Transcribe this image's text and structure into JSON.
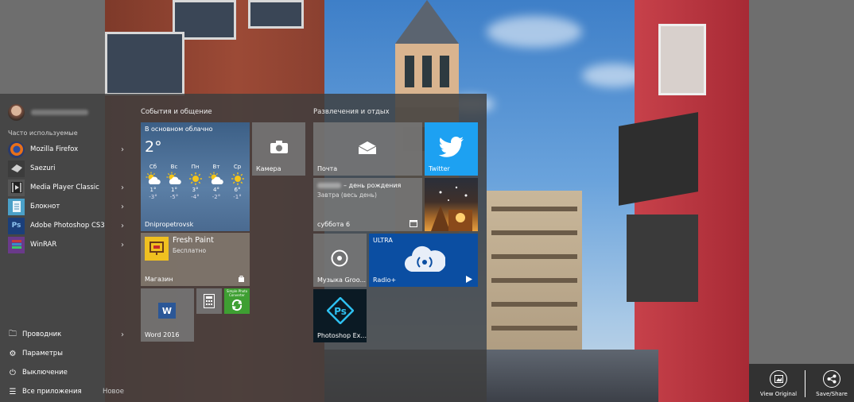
{
  "start_menu": {
    "most_used_label": "Часто используемые",
    "apps": [
      {
        "name": "Mozilla Firefox",
        "icon": "firefox-icon",
        "has_submenu": true
      },
      {
        "name": "Saezuri",
        "icon": "saezuri-icon",
        "has_submenu": false
      },
      {
        "name": "Media Player Classic",
        "icon": "media-player-icon",
        "has_submenu": true
      },
      {
        "name": "Блокнот",
        "icon": "notepad-icon",
        "has_submenu": true
      },
      {
        "name": "Adobe Photoshop CS3",
        "icon": "photoshop-icon",
        "has_submenu": true
      },
      {
        "name": "WinRAR",
        "icon": "winrar-icon",
        "has_submenu": true
      }
    ],
    "bottom": {
      "explorer": "Проводник",
      "settings": "Параметры",
      "power": "Выключение",
      "all_apps": "Все приложения",
      "new_badge": "Новое"
    },
    "group1_title": "События и общение",
    "group2_title": "Развлечения и отдых",
    "weather": {
      "header": "В основном облачно",
      "temp": "2°",
      "city": "Dnipropetrovsk",
      "days": [
        {
          "day": "Сб",
          "hi": "1°",
          "lo": "-3°",
          "icon": "partly-cloudy-icon"
        },
        {
          "day": "Вс",
          "hi": "1°",
          "lo": "-5°",
          "icon": "partly-cloudy-icon"
        },
        {
          "day": "Пн",
          "hi": "3°",
          "lo": "-4°",
          "icon": "sun-icon"
        },
        {
          "day": "Вт",
          "hi": "4°",
          "lo": "-2°",
          "icon": "partly-cloudy-icon"
        },
        {
          "day": "Ср",
          "hi": "6°",
          "lo": "-1°",
          "icon": "sun-icon"
        }
      ]
    },
    "tiles": {
      "camera": "Камера",
      "mail": "Почта",
      "twitter": "Twitter",
      "calendar_event": "– день рождения",
      "calendar_sub": "Завтра (весь день)",
      "calendar_date": "суббота 6",
      "store_app": "Fresh Paint",
      "store_price": "Бесплатно",
      "store_label": "Магазин",
      "music": "Музыка Groo...",
      "radio_brand": "ULTRA",
      "radio_label": "Radio+",
      "word": "Word 2016",
      "photoshop_express": "Photoshop Ex...",
      "photo_converter": "Simple Photo Converter"
    }
  },
  "viewer_buttons": {
    "view_original": "View Original",
    "save_share": "Save/Share"
  }
}
